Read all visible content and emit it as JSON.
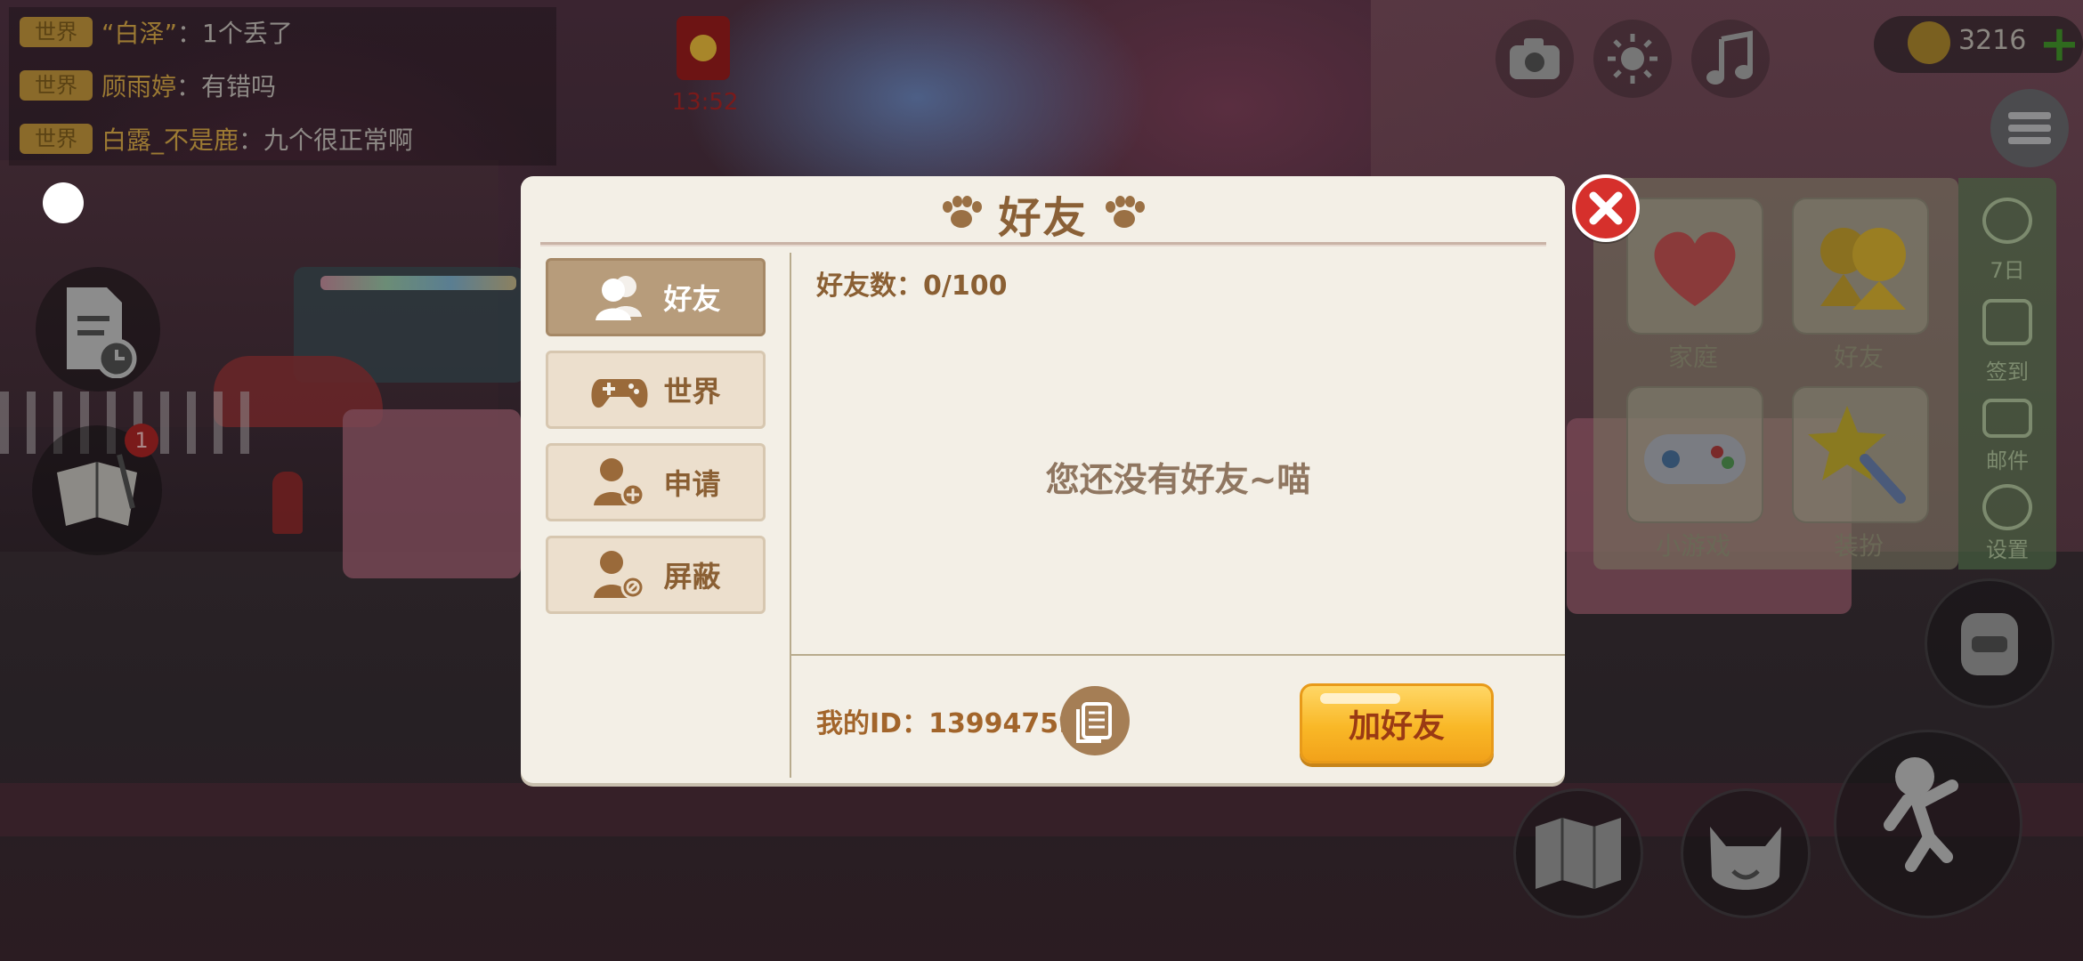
{
  "chat": {
    "messages": [
      {
        "tag": "世界",
        "user": "“白泽”",
        "text": "：1个丢了"
      },
      {
        "tag": "世界",
        "user": "顾雨婷",
        "text": "：有错吗"
      },
      {
        "tag": "世界",
        "user": "白露_不是鹿",
        "text": "：九个很正常啊"
      }
    ]
  },
  "red_envelope": {
    "timer": "13:52"
  },
  "notebook_badge": "1",
  "coins": {
    "value": "3216"
  },
  "side_menu": {
    "tiles": [
      "家庭",
      "好友",
      "小游戏",
      "装扮"
    ],
    "strip": [
      "7日",
      "签到",
      "邮件",
      "设置"
    ]
  },
  "dialog": {
    "title": "好友",
    "tabs": [
      {
        "label": "好友",
        "icon": "friends-icon",
        "active": true
      },
      {
        "label": "世界",
        "icon": "gamepad-icon",
        "active": false
      },
      {
        "label": "申请",
        "icon": "add-person-icon",
        "active": false
      },
      {
        "label": "屏蔽",
        "icon": "block-person-icon",
        "active": false
      }
    ],
    "friend_count": "好友数：0/100",
    "empty_message": "您还没有好友~喵",
    "my_id": "我的ID：13994759",
    "add_friend_label": "加好友"
  }
}
